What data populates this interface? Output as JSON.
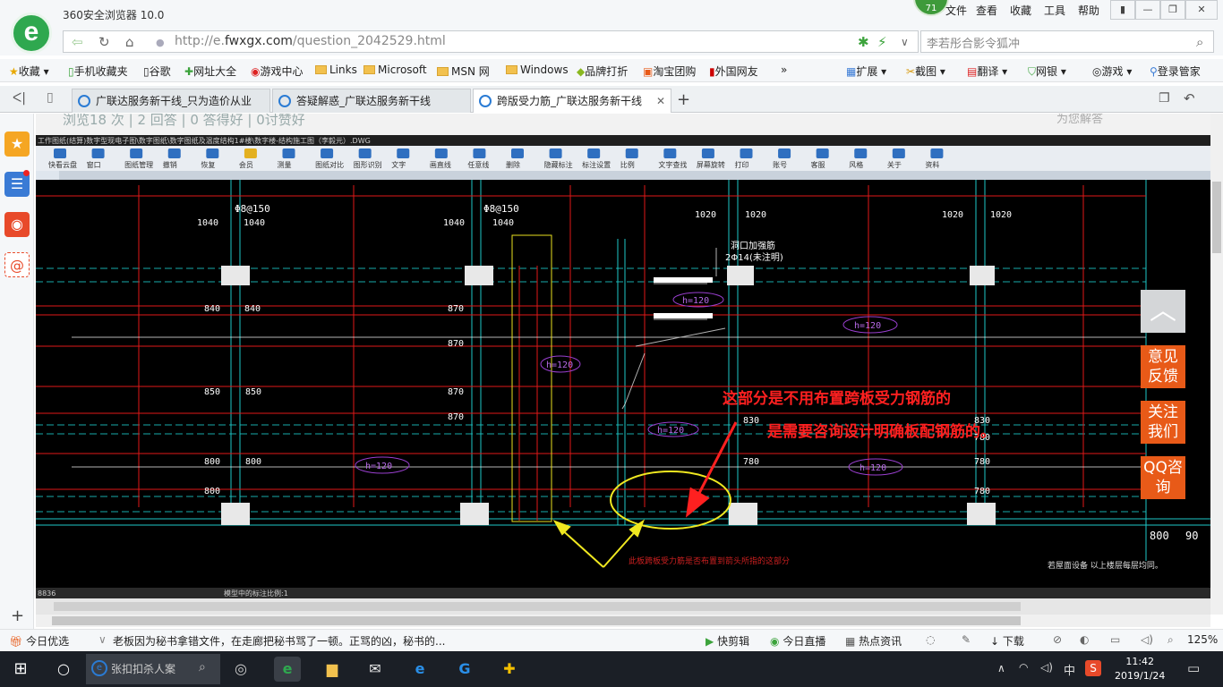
{
  "browser": {
    "title": "360安全浏览器 10.0",
    "badge_count": "71",
    "menu": [
      "文件",
      "查看",
      "收藏",
      "工具",
      "帮助"
    ],
    "url_prefix": "http://e.",
    "url_domain": "fwxgx.com",
    "url_path": "/question_2042529.html",
    "search_text": "李若彤合影令狐冲"
  },
  "bookmarks": {
    "items": [
      "收藏",
      "手机收藏夹",
      "谷歌",
      "网址大全",
      "游戏中心",
      "Links",
      "Microsoft",
      "MSN 网",
      "Windows",
      "品牌打折",
      "淘宝团购",
      "外国网友"
    ],
    "more": "»",
    "right": [
      "扩展",
      "截图",
      "翻译",
      "网银",
      "游戏",
      "登录管家"
    ]
  },
  "tabs": [
    {
      "label": "广联达服务新干线_只为造价从业"
    },
    {
      "label": "答疑解惑_广联达服务新干线"
    },
    {
      "label": "跨版受力筋_广联达服务新干线"
    }
  ],
  "page": {
    "faded_header": "浏览18 次 | 2 回答 | 0 答得好 | 0讨赞好",
    "faded_right": "为您解答",
    "cad_title": "工作图纸(结算)数字型现电子图\\数字图纸\\数字图纸及温度结构1#楼\\数字楼-结构施工图（李毅元）.DWG",
    "toolbar": [
      "快看云盘",
      "窗口",
      "图纸管理",
      "撤销",
      "恢复",
      "会员",
      "测量",
      "图纸对比",
      "图形识别",
      "文字",
      "画直线",
      "任意线",
      "删除",
      "隐藏标注",
      "标注设置",
      "比例",
      "文字查找",
      "屏幕旋转",
      "打印",
      "账号",
      "客服",
      "风格",
      "关于",
      "资料"
    ],
    "cad_status_left": "8836",
    "cad_status_mid": "模型中的标注比例:1",
    "annotation_line1": "这部分是不用布置跨板受力钢筋的",
    "annotation_line2": "是需要咨询设计明确板配钢筋的。",
    "bottom_note": "此板跨板受力筋是否布置到箭头所指的这部分",
    "bottom_right_note": "若屋面设备 以上楼层每层均同。",
    "rebar_labels": [
      "Φ8@150",
      "Φ8@150"
    ],
    "dim_labels": [
      "1040",
      "1040",
      "1040",
      "1040",
      "1020",
      "1020",
      "1020",
      "1020",
      "840",
      "840",
      "870",
      "870",
      "870",
      "850",
      "850",
      "870",
      "830",
      "830",
      "800",
      "800",
      "780",
      "780",
      "800",
      "780",
      "780",
      "800",
      "90"
    ],
    "h_labels": [
      "h=120",
      "h=120",
      "h=120",
      "h=120",
      "h=120",
      "h=120"
    ],
    "hole_label_1": "洞口加强筋",
    "hole_label_2": "2Φ14(未注明)",
    "float_buttons": [
      "意见反馈",
      "关注我们",
      "QQ咨询"
    ]
  },
  "statusbar": {
    "left": "今日优选",
    "news": "老板因为秘书拿错文件，在走廊把秘书骂了一顿。正骂的凶，秘书的...",
    "right": [
      "快剪辑",
      "今日直播",
      "热点资讯",
      "下载"
    ],
    "zoom": "125%"
  },
  "taskbar": {
    "search": "张扣扣杀人案",
    "ime": "中",
    "time": "11:42",
    "date": "2019/1/24"
  },
  "colors": {
    "accent": "#e85a18",
    "tab_active": "#ffffff",
    "cad_bg": "#000000",
    "annotation": "#ff2020"
  }
}
